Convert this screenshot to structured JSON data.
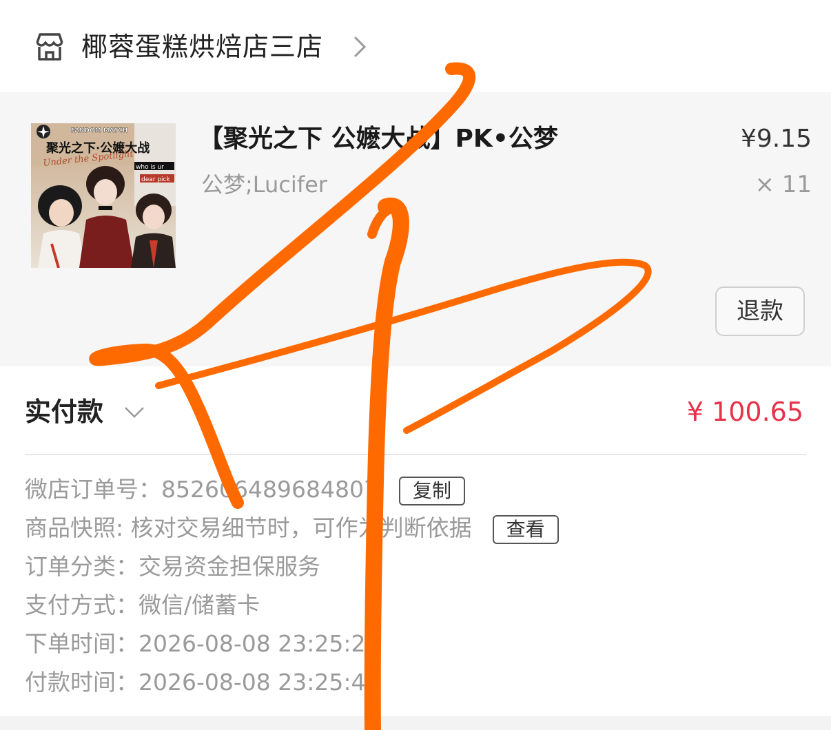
{
  "shop": {
    "name": "椰蓉蛋糕烘焙店三店",
    "icon": "store-icon"
  },
  "item": {
    "title": "【聚光之下 公嬷大战】PK•公梦",
    "spec": "公梦;Lucifer",
    "price": "¥9.15",
    "quantity": "× 11",
    "refund_label": "退款",
    "thumbnail": {
      "top_text": "FANDOM MATCH",
      "title_text": "聚光之下·公嬷大战",
      "script_text": "Under the Spotlight",
      "tag1": "who is ur",
      "tag2": "dear pick"
    }
  },
  "payment": {
    "label": "实付款",
    "amount": "¥ 100.65"
  },
  "details": {
    "order_no_label": "微店订单号：",
    "order_no": "852606489684807",
    "copy_label": "复制",
    "snapshot_label": "商品快照:",
    "snapshot_text": "核对交易细节时，可作为判断依据",
    "view_label": "查看",
    "category_label": "订单分类：",
    "category": "交易资金担保服务",
    "pay_method_label": "支付方式：",
    "pay_method": "微信/储蓄卡",
    "order_time_label": "下单时间：",
    "order_time": "2026-08-08 23:25:29",
    "pay_time_label": "付款时间：",
    "pay_time": "2026-08-08 23:25:44"
  },
  "colors": {
    "accent_price": "#e8324a",
    "annotation": "#ff6a00",
    "card_bg": "#f6f6f6"
  }
}
